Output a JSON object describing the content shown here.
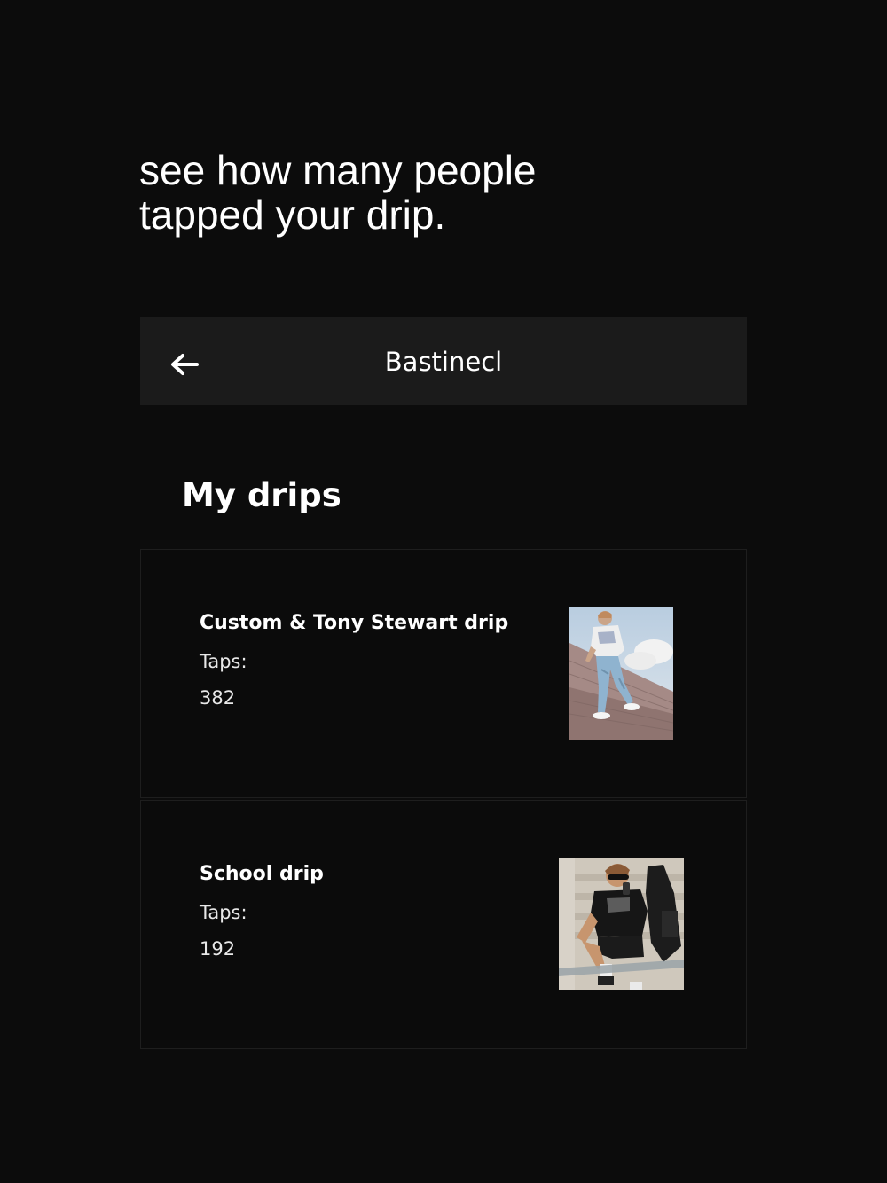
{
  "promo": {
    "line1": "see how many people",
    "line2": "tapped your drip."
  },
  "header": {
    "back_icon": "arrow-left-icon",
    "title": "Bastinecl"
  },
  "section": {
    "title": "My drips"
  },
  "drips": [
    {
      "name": "Custom & Tony Stewart drip",
      "taps_label": "Taps:",
      "taps": "382"
    },
    {
      "name": "School drip",
      "taps_label": "Taps:",
      "taps": "192"
    }
  ],
  "colors": {
    "background": "#0c0c0c",
    "header_bg": "#1b1b1b",
    "card_border": "#1e1e1e",
    "text": "#ffffff"
  }
}
